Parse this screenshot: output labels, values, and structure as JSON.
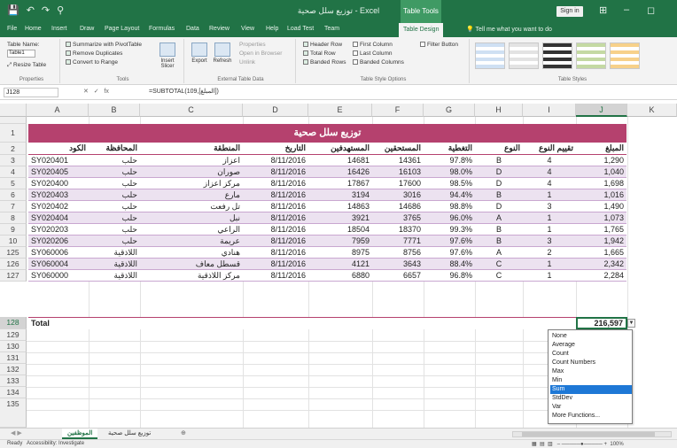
{
  "window": {
    "title": "توزيع سلل صحية - Excel",
    "context_tab": "Table Tools",
    "signin": "Sign in",
    "qat": [
      "💾",
      "↶",
      "↷",
      "⚲"
    ]
  },
  "ribbon_tabs": [
    {
      "label": "File",
      "active": false
    },
    {
      "label": "Home",
      "active": false
    },
    {
      "label": "Insert",
      "active": false
    },
    {
      "label": "Draw",
      "active": false
    },
    {
      "label": "Page Layout",
      "active": false
    },
    {
      "label": "Formulas",
      "active": false
    },
    {
      "label": "Data",
      "active": false
    },
    {
      "label": "Review",
      "active": false
    },
    {
      "label": "View",
      "active": false
    },
    {
      "label": "Help",
      "active": false
    },
    {
      "label": "Load Test",
      "active": false
    },
    {
      "label": "Team",
      "active": false
    },
    {
      "label": "Table Design",
      "active": true
    }
  ],
  "tell_me": "Tell me what you want to do",
  "ribbon": {
    "properties": {
      "name_label": "Table Name:",
      "name_value": "Table1",
      "resize": "Resize Table",
      "group": "Properties"
    },
    "tools": {
      "pivot": "Summarize with PivotTable",
      "dupes": "Remove Duplicates",
      "range": "Convert to Range",
      "slicer": "Insert Slicer",
      "group": "Tools"
    },
    "external": {
      "export": "Export",
      "refresh": "Refresh",
      "props": "Properties",
      "browser": "Open in Browser",
      "unlink": "Unlink",
      "group": "External Table Data"
    },
    "style_options": {
      "header_row": "Header Row",
      "total_row": "Total Row",
      "banded_rows": "Banded Rows",
      "first_column": "First Column",
      "last_column": "Last Column",
      "banded_columns": "Banded Columns",
      "filter_button": "Filter Button",
      "group": "Table Style Options"
    },
    "styles": {
      "group": "Table Styles"
    }
  },
  "formula_bar": {
    "name_box": "J128",
    "fx": "fx",
    "formula": "=SUBTOTAL(109,[المبلغ])"
  },
  "columns": [
    "A",
    "B",
    "C",
    "D",
    "E",
    "F",
    "G",
    "H",
    "I",
    "J",
    "K"
  ],
  "selected_column": "J",
  "table": {
    "title": "توزيع سلل صحية",
    "headers": {
      "a": "الكود",
      "b": "المحافظة",
      "c": "المنطقة",
      "d": "التاريخ",
      "e": "المستهدفين",
      "f": "المستحقين",
      "g": "التغطية",
      "h": "النوع",
      "i": "تقييم النوع",
      "j": "المبلغ"
    },
    "rows": [
      {
        "num": "3",
        "a": "SY020401",
        "b": "حلب",
        "c": "اعزاز",
        "d": "8/11/2016",
        "e": "14681",
        "f": "14361",
        "g": "97.8%",
        "h": "B",
        "i": "4",
        "j": "1,290"
      },
      {
        "num": "4",
        "a": "SY020405",
        "b": "حلب",
        "c": "صوران",
        "d": "8/11/2016",
        "e": "16426",
        "f": "16103",
        "g": "98.0%",
        "h": "D",
        "i": "4",
        "j": "1,040"
      },
      {
        "num": "5",
        "a": "SY020400",
        "b": "حلب",
        "c": "مركز اعزاز",
        "d": "8/11/2016",
        "e": "17867",
        "f": "17600",
        "g": "98.5%",
        "h": "D",
        "i": "4",
        "j": "1,698"
      },
      {
        "num": "6",
        "a": "SY020403",
        "b": "حلب",
        "c": "مارع",
        "d": "8/11/2016",
        "e": "3194",
        "f": "3016",
        "g": "94.4%",
        "h": "B",
        "i": "1",
        "j": "1,016"
      },
      {
        "num": "7",
        "a": "SY020402",
        "b": "حلب",
        "c": "تل رفعت",
        "d": "8/11/2016",
        "e": "14863",
        "f": "14686",
        "g": "98.8%",
        "h": "D",
        "i": "3",
        "j": "1,490"
      },
      {
        "num": "8",
        "a": "SY020404",
        "b": "حلب",
        "c": "نبل",
        "d": "8/11/2016",
        "e": "3921",
        "f": "3765",
        "g": "96.0%",
        "h": "A",
        "i": "1",
        "j": "1,073"
      },
      {
        "num": "9",
        "a": "SY020203",
        "b": "حلب",
        "c": "الراعي",
        "d": "8/11/2016",
        "e": "18504",
        "f": "18370",
        "g": "99.3%",
        "h": "B",
        "i": "1",
        "j": "1,765"
      },
      {
        "num": "10",
        "a": "SY020206",
        "b": "حلب",
        "c": "عريمة",
        "d": "8/11/2016",
        "e": "7959",
        "f": "7771",
        "g": "97.6%",
        "h": "B",
        "i": "3",
        "j": "1,942"
      },
      {
        "num": "125",
        "a": "SY060006",
        "b": "اللاذقية",
        "c": "هنادي",
        "d": "8/11/2016",
        "e": "8975",
        "f": "8756",
        "g": "97.6%",
        "h": "A",
        "i": "2",
        "j": "1,665"
      },
      {
        "num": "126",
        "a": "SY060004",
        "b": "اللاذقية",
        "c": "قسطل معاف",
        "d": "8/11/2016",
        "e": "4121",
        "f": "3643",
        "g": "88.4%",
        "h": "C",
        "i": "1",
        "j": "2,342"
      },
      {
        "num": "127",
        "a": "SY060000",
        "b": "اللاذقية",
        "c": "مركز اللاذقية",
        "d": "8/11/2016",
        "e": "6880",
        "f": "6657",
        "g": "96.8%",
        "h": "C",
        "i": "1",
        "j": "2,284"
      }
    ],
    "total_label": "Total",
    "total_value": "216,597"
  },
  "extra_rows": [
    "129",
    "130",
    "131",
    "132",
    "133",
    "134",
    "135"
  ],
  "header_row_nums": [
    "1",
    "2"
  ],
  "total_row_num": "128",
  "dropdown": {
    "items": [
      "None",
      "Average",
      "Count",
      "Count Numbers",
      "Max",
      "Min",
      "Sum",
      "StdDev",
      "Var",
      "More Functions..."
    ],
    "selected": "Sum"
  },
  "sheets": [
    {
      "label": "الموظفين",
      "active": true
    },
    {
      "label": "توزيع سلل صحية",
      "active": false
    }
  ],
  "add_sheet": "⊕",
  "status": {
    "ready": "Ready",
    "accessibility": "Accessibility: Investigate",
    "zoom": "100%"
  },
  "colors": {
    "excel_green": "#217346",
    "table_header": "#b5416e",
    "band": "#ece2f0",
    "selection": "#1e78d6"
  }
}
